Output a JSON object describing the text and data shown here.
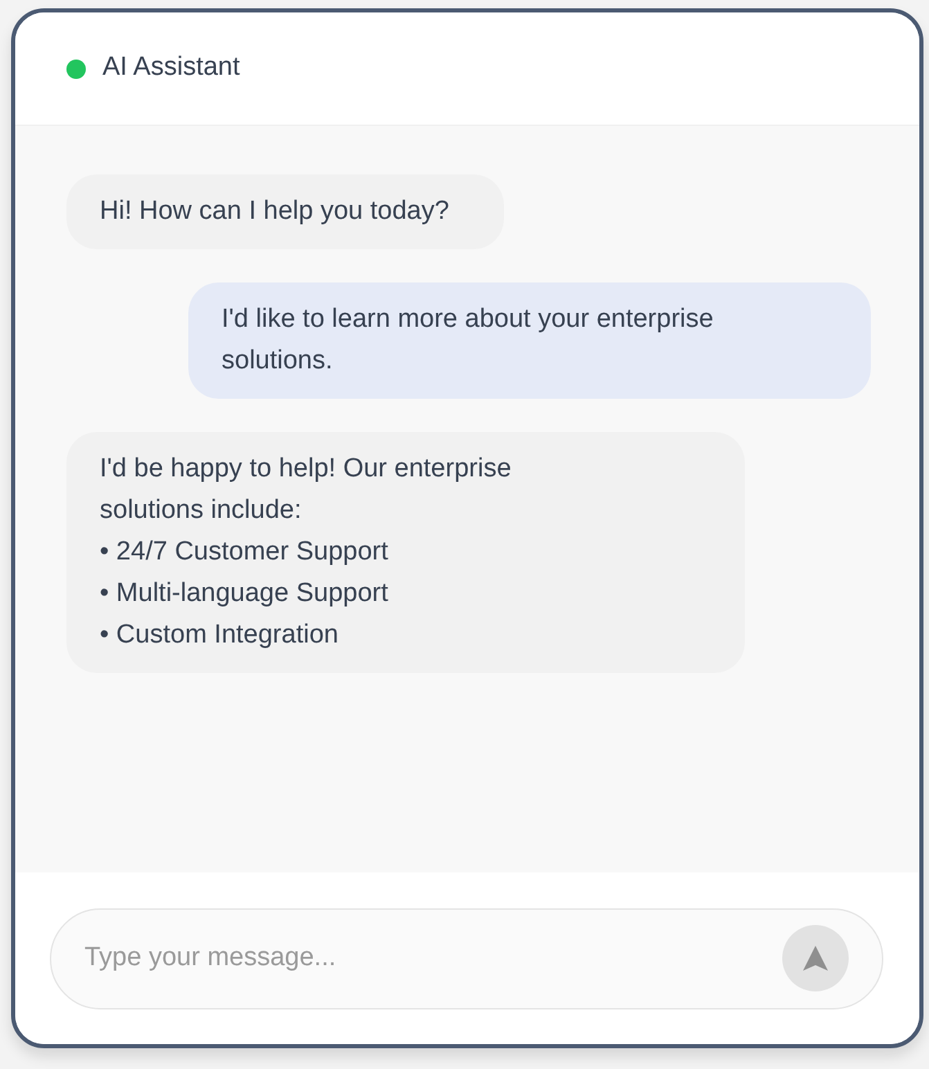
{
  "header": {
    "title": "AI Assistant",
    "online": true
  },
  "messages": [
    {
      "kind": "assistant",
      "text": "Hi! How can I help you today?"
    },
    {
      "kind": "user",
      "text": "I'd like to learn more about your enterprise solutions."
    },
    {
      "kind": "assistant",
      "text": "I'd be happy to help! Our enterprise\nsolutions include:\n• 24/7 Customer Support\n• Multi-language Support\n• Custom Integration"
    }
  ],
  "composer": {
    "placeholder": "Type your message..."
  }
}
